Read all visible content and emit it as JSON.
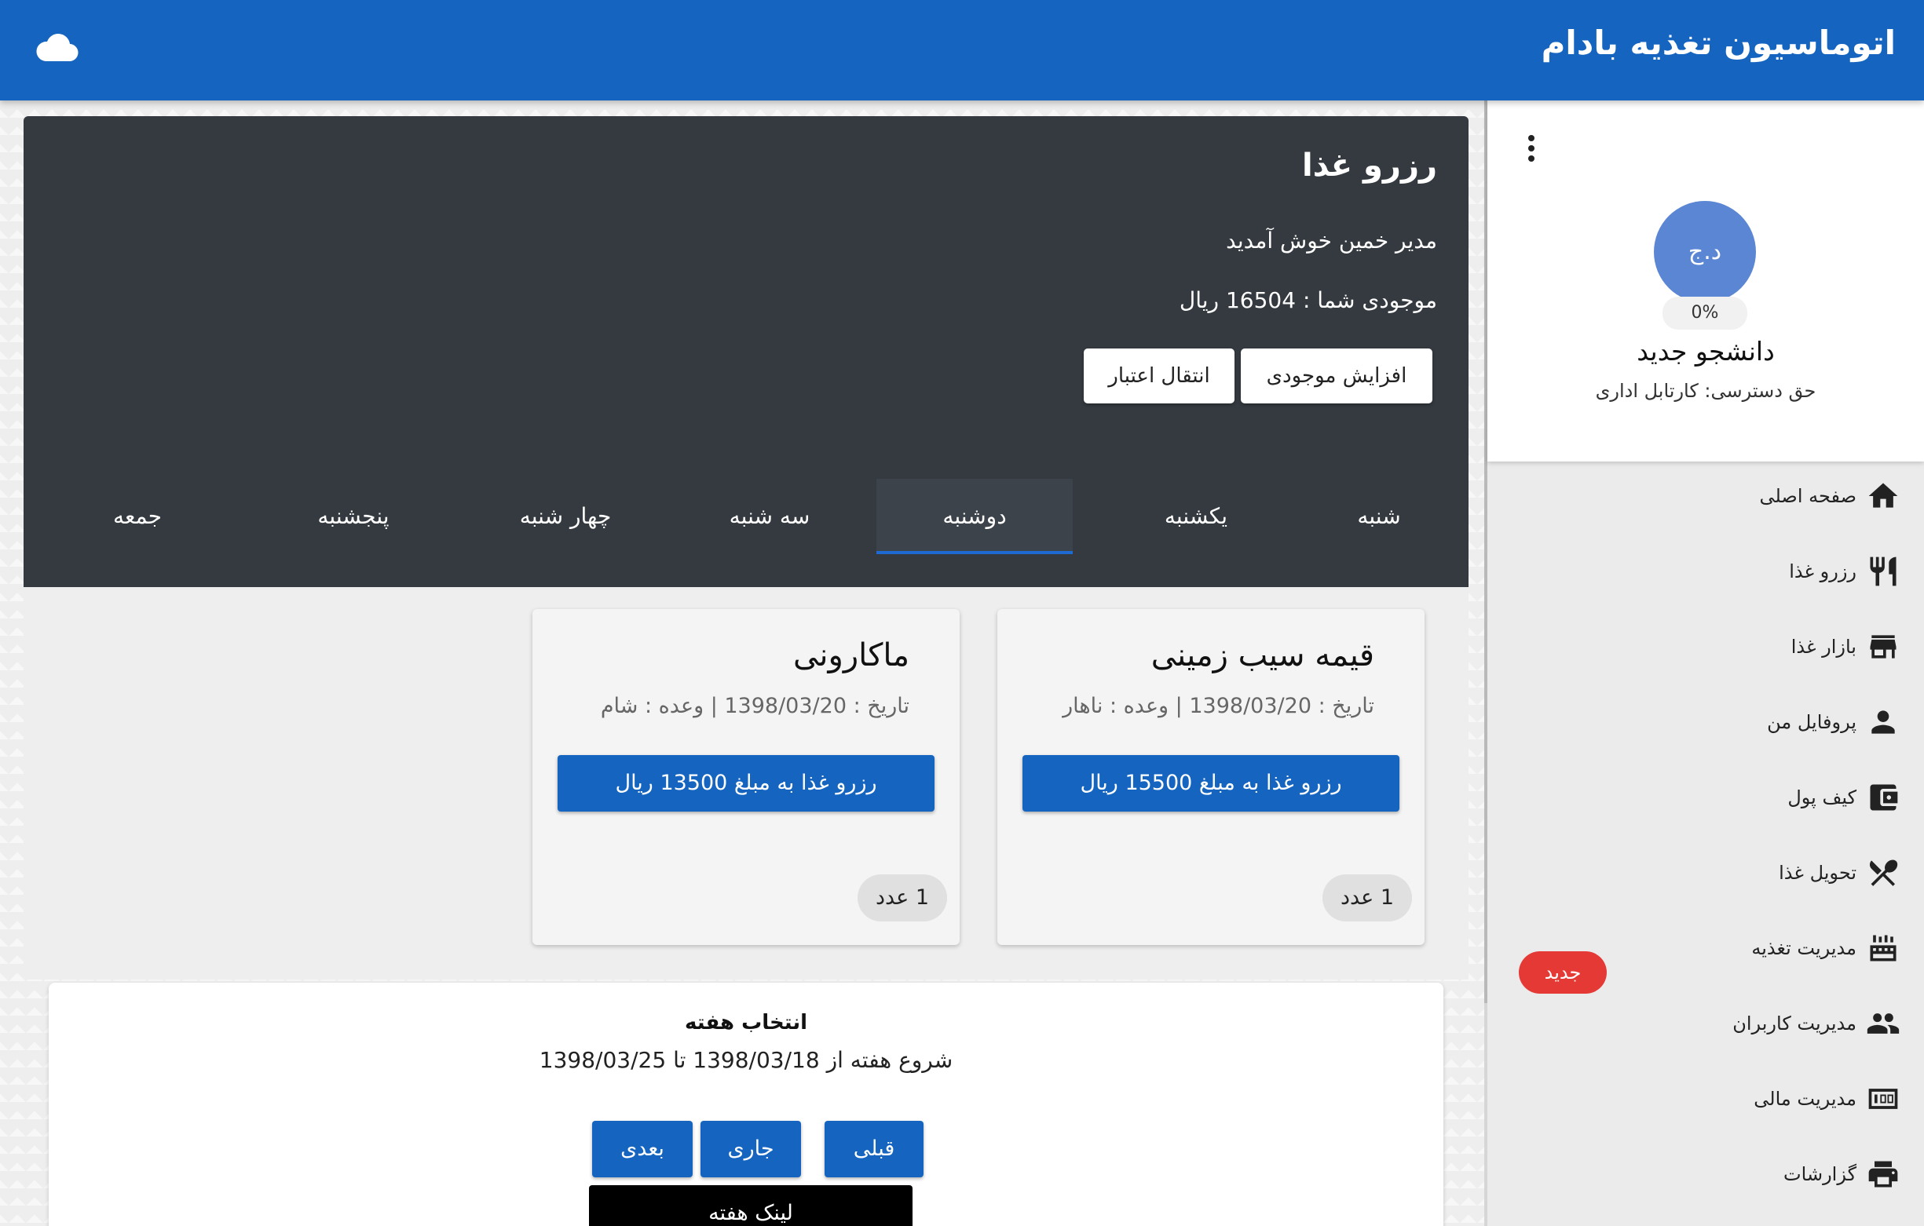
{
  "app": {
    "title": "اتوماسیون تغذیه بادام",
    "cloud_icon": "cloud-icon",
    "brand_color": "#1565c0"
  },
  "profile": {
    "avatar_initials": "د.ج",
    "progress": "0%",
    "name": "دانشجو جدید",
    "access": "حق دسترسی: کارتابل اداری",
    "menu_icon": "more-vert-icon"
  },
  "sidebar": {
    "items": [
      {
        "label": "صفحه اصلی",
        "icon": "home-icon"
      },
      {
        "label": "رزرو غذا",
        "icon": "restaurant-icon"
      },
      {
        "label": "بازار غذا",
        "icon": "store-icon"
      },
      {
        "label": "پروفایل من",
        "icon": "person-icon"
      },
      {
        "label": "کیف پول",
        "icon": "wallet-icon"
      },
      {
        "label": "تحویل غذا",
        "icon": "utensils-cross-icon"
      },
      {
        "label": "مدیریت تغذیه",
        "icon": "kitchen-icon"
      },
      {
        "label": "مدیریت کاربران",
        "icon": "people-icon"
      },
      {
        "label": "مدیریت مالی",
        "icon": "money-icon"
      },
      {
        "label": "گزارشات",
        "icon": "print-icon"
      }
    ],
    "new_badge": "جدید",
    "badge_color": "#e53935"
  },
  "hero": {
    "title": "رزرو غذا",
    "welcome": "مدیر خمین خوش آمدید",
    "balance": "موجودی شما : 16504 ریال",
    "increase_button": "افزایش موجودی",
    "transfer_button": "انتقال اعتبار"
  },
  "tabs": {
    "items": [
      "شنبه",
      "یکشنبه",
      "دوشنبه",
      "سه شنبه",
      "چهار شنبه",
      "پنجشنبه",
      "جمعه"
    ],
    "active": "دوشنبه"
  },
  "meals": [
    {
      "title": "قیمه سیب زمینی",
      "meta": "تاریخ : 1398/03/20 | وعده : ناهار",
      "button": "رزرو غذا به مبلغ 15500 ریال",
      "qty": "1 عدد"
    },
    {
      "title": "ماکارونی",
      "meta": "تاریخ : 1398/03/20 | وعده : شام",
      "button": "رزرو غذا به مبلغ 13500 ریال",
      "qty": "1 عدد"
    }
  ],
  "week": {
    "title": "انتخاب هفته",
    "range": "شروع هفته از 1398/03/18 تا 1398/03/25",
    "prev": "قبلی",
    "current": "جاری",
    "next": "بعدی",
    "link": "لینک هفته"
  }
}
